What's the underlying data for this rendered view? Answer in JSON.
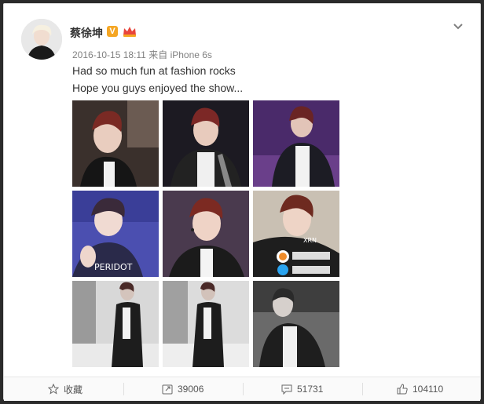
{
  "post": {
    "author_name": "蔡徐坤",
    "verified_badge": "V",
    "timestamp": "2016-10-15 18:11",
    "source_prefix": "来自",
    "source": "iPhone 6s",
    "line1": "Had so much fun at fashion rocks",
    "line2": "Hope you guys enjoyed the show..."
  },
  "photos": [
    {
      "name": "photo-1",
      "watermark": ""
    },
    {
      "name": "photo-2",
      "watermark": ""
    },
    {
      "name": "photo-3",
      "watermark": ""
    },
    {
      "name": "photo-4",
      "watermark": "PERIDOT"
    },
    {
      "name": "photo-5",
      "watermark": ""
    },
    {
      "name": "photo-6",
      "watermark": "XRN"
    },
    {
      "name": "photo-7",
      "watermark": ""
    },
    {
      "name": "photo-8",
      "watermark": ""
    },
    {
      "name": "photo-9",
      "watermark": ""
    }
  ],
  "actions": {
    "favorite_label": "收藏",
    "repost_count": "39006",
    "comment_count": "51731",
    "like_count": "104110"
  },
  "icons": {
    "favorite": "star-icon",
    "repost": "repost-icon",
    "comment": "comment-icon",
    "like": "thumbs-up-icon",
    "menu": "chevron-down-icon"
  },
  "colors": {
    "badge": "#f5a623",
    "crown": "#e8453c",
    "accent": "#eb7350"
  }
}
